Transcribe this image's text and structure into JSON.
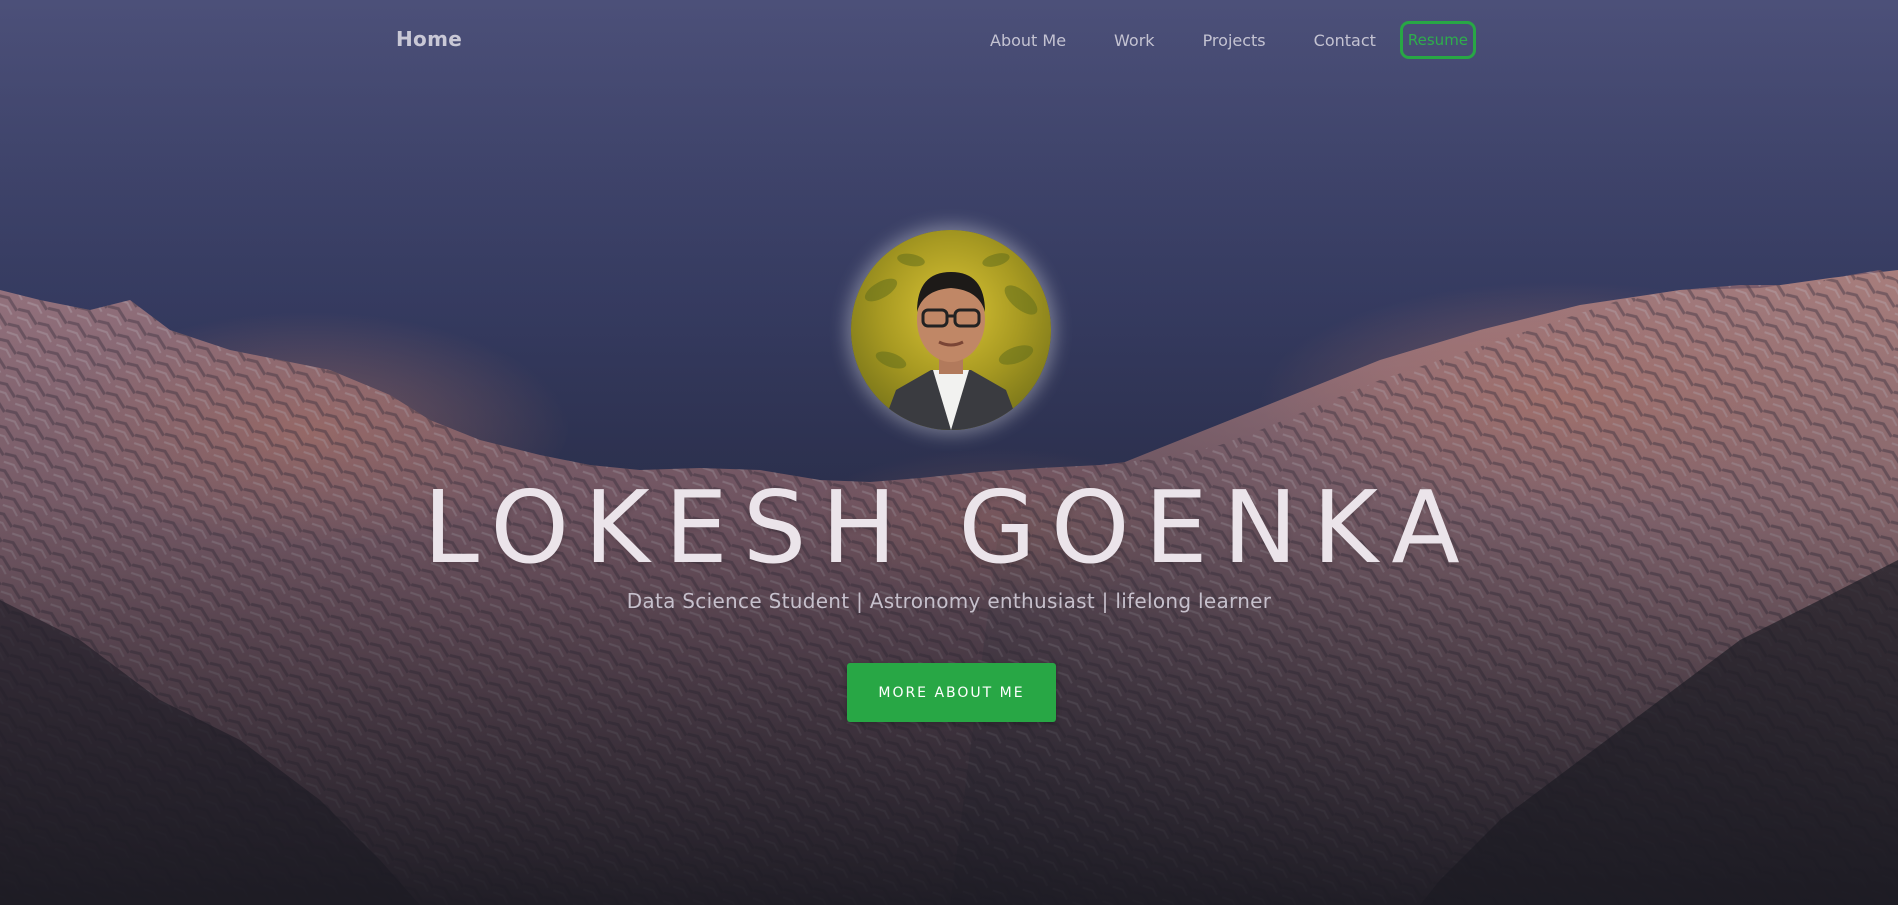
{
  "navbar": {
    "brand": "Home",
    "links": [
      "About Me",
      "Work",
      "Projects",
      "Contact"
    ],
    "resume": "Resume"
  },
  "hero": {
    "name": "LOKESH GOENKA",
    "tagline": "Data Science Student | Astronomy enthusiast | lifelong learner",
    "cta": "MORE ABOUT ME"
  },
  "colors": {
    "accent": "#28a745",
    "sky_top": "#4b4f78",
    "sky_mid": "#3a416c",
    "mountain_glow": "#c98476",
    "name_text": "#ebe4ea"
  }
}
